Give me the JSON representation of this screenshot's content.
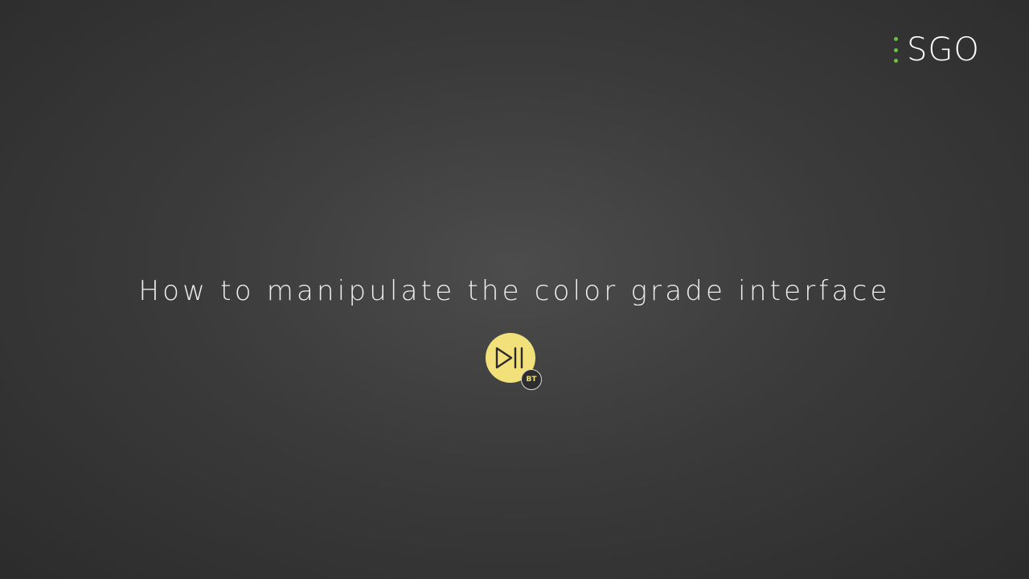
{
  "brand": {
    "name": "SGO",
    "dot_color": "#6cbf45"
  },
  "title": "How to manipulate the color grade interface",
  "badge": {
    "icon": "play-skip-icon",
    "circle_color": "#f2e07a",
    "level": "BT"
  }
}
